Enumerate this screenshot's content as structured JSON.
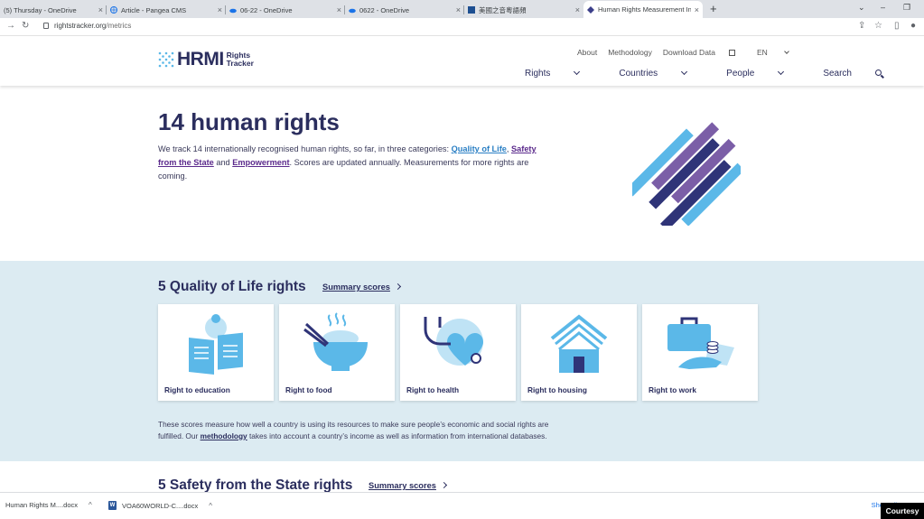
{
  "browser": {
    "tabs": [
      {
        "label": "(5) Thursday - OneDrive",
        "close": "×"
      },
      {
        "label": "Article - Pangea CMS",
        "close": "×"
      },
      {
        "label": "06-22 - OneDrive",
        "close": "×"
      },
      {
        "label": "0622 - OneDrive",
        "close": "×"
      },
      {
        "label": "美國之音粵語頻",
        "close": "×"
      },
      {
        "label": "Human Rights Measurement Init",
        "close": "×"
      }
    ],
    "new_tab": "+",
    "url_domain": "rightstracker.org",
    "url_path": "/metrics"
  },
  "site": {
    "logo_main": "HRMI",
    "logo_sub_1": "Rights",
    "logo_sub_2": "Tracker",
    "util_links": {
      "about": "About",
      "methodology": "Methodology",
      "download": "Download Data",
      "lang": "EN"
    },
    "nav": {
      "rights": "Rights",
      "countries": "Countries",
      "people": "People",
      "search": "Search"
    }
  },
  "hero": {
    "title": "14 human rights",
    "text_1": "We track 14 internationally recognised human rights, so far, in three categories: ",
    "link_qol": "Quality of Life",
    "text_2": ", ",
    "link_safety": "Safety from the State",
    "text_3": " and ",
    "link_empower": "Empowerment",
    "text_4": ". Scores are updated annually. Measurements for more rights are coming."
  },
  "qol": {
    "title": "5 Quality of Life rights",
    "summary_label": "Summary scores",
    "cards": [
      {
        "label": "Right to education",
        "icon": "education-icon"
      },
      {
        "label": "Right to food",
        "icon": "food-icon"
      },
      {
        "label": "Right to health",
        "icon": "health-icon"
      },
      {
        "label": "Right to housing",
        "icon": "housing-icon"
      },
      {
        "label": "Right to work",
        "icon": "work-icon"
      }
    ],
    "note_1": "These scores measure how well a country is using its resources to make sure people’s economic and social rights are fulfilled. Our ",
    "note_link": "methodology",
    "note_2": " takes into account a country’s income as well as information from international databases."
  },
  "safety": {
    "title": "5 Safety from the State rights",
    "summary_label": "Summary scores"
  },
  "downloads": {
    "items": [
      {
        "label": "Human Rights M....docx",
        "caret": "^"
      },
      {
        "label": "VOA60WORLD-C....docx",
        "caret": "^"
      }
    ],
    "show_all": "Show all"
  },
  "overlay": {
    "courtesy": "Courtesy"
  },
  "colors": {
    "accent": "#2b2e5e",
    "light_blue": "#5bb8e8",
    "purple": "#7b5ea7",
    "section_bg": "#dcebf2"
  }
}
